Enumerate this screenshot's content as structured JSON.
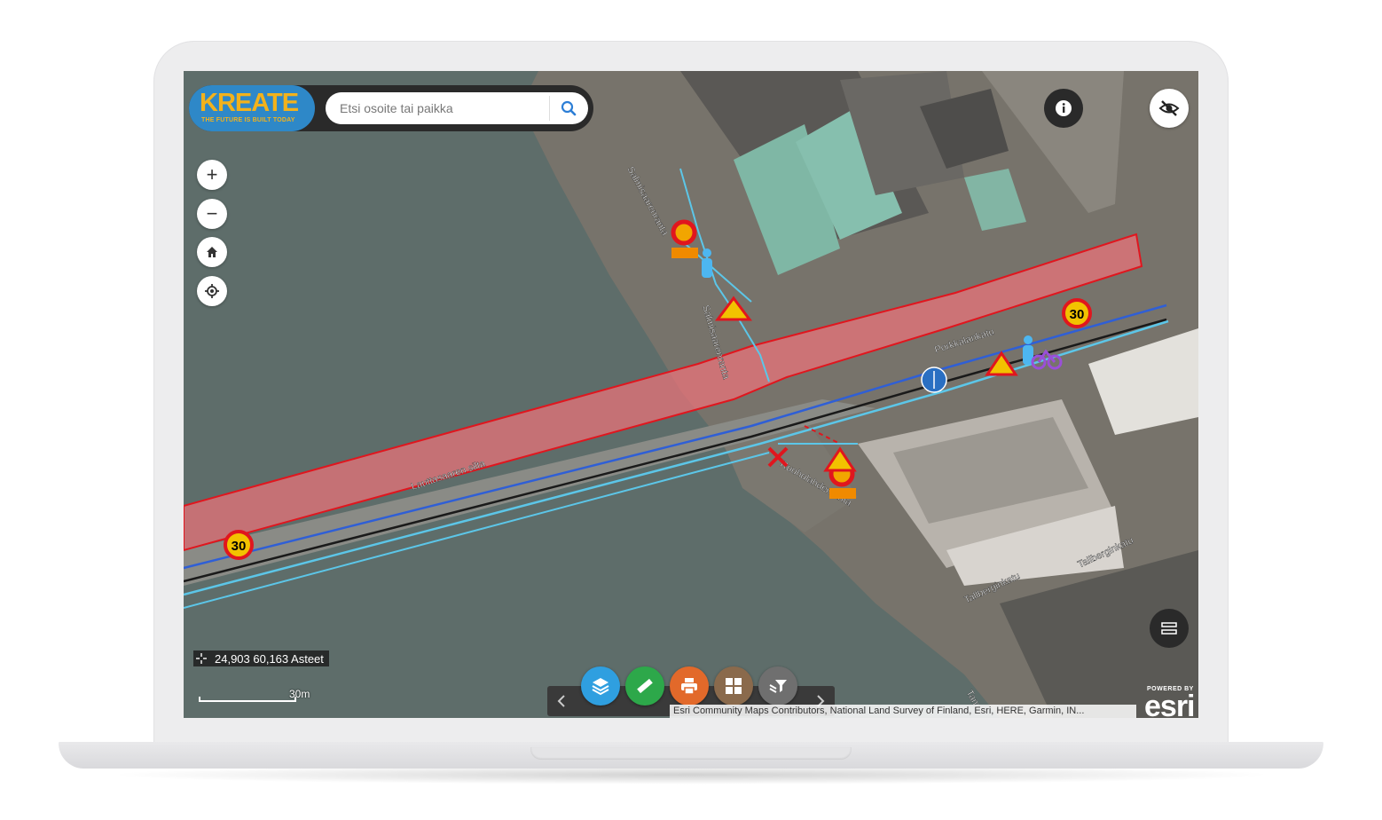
{
  "app": {
    "logo_text": "KREATE",
    "logo_tagline": "THE FUTURE IS BUILT TODAY"
  },
  "search": {
    "placeholder": "Etsi osoite tai paikka",
    "icon": "search-icon"
  },
  "zoom_controls": {
    "zoom_in": "+",
    "zoom_out": "−",
    "home_icon": "home-icon",
    "locate_icon": "locate-icon"
  },
  "top_right": {
    "info_icon": "info-icon",
    "visibility_icon": "eye-off-icon"
  },
  "coordinates": {
    "text": "24,903 60,163 Asteet"
  },
  "scale": {
    "label": "30m"
  },
  "toolbar": {
    "buttons": [
      {
        "icon": "layers-icon",
        "color": "#2f9fe0"
      },
      {
        "icon": "measure-icon",
        "color": "#2da84a"
      },
      {
        "icon": "print-icon",
        "color": "#e2692a"
      },
      {
        "icon": "basemap-gallery-icon",
        "color": "#8a6a4c"
      },
      {
        "icon": "layer-filter-icon",
        "color": "#6f6f6f"
      }
    ],
    "prev_icon": "chevron-left-icon",
    "next_icon": "chevron-right-icon"
  },
  "attribution": {
    "text": "Esri Community Maps Contributors, National Land Survey of Finland, Esri, HERE, Garmin, IN..."
  },
  "esri": {
    "powered_by": "POWERED BY",
    "wordmark": "esri"
  },
  "map": {
    "street_labels": [
      "Salmisaarenranta",
      "Salmisaarenranta",
      "Porkkalankatu",
      "Lauttasaaren silta",
      "Ruoholahdenranta",
      "Tallberginkatu",
      "Tallberginkatu",
      "Tamm"
    ],
    "speed_limit_1": "30",
    "speed_limit_2": "30",
    "colors": {
      "water": "#5e6d6a",
      "closure_area": "#e8737a",
      "closure_outline": "#e0161e",
      "route_blue": "#2f5fd6",
      "route_cyan": "#5cc6e8"
    }
  }
}
